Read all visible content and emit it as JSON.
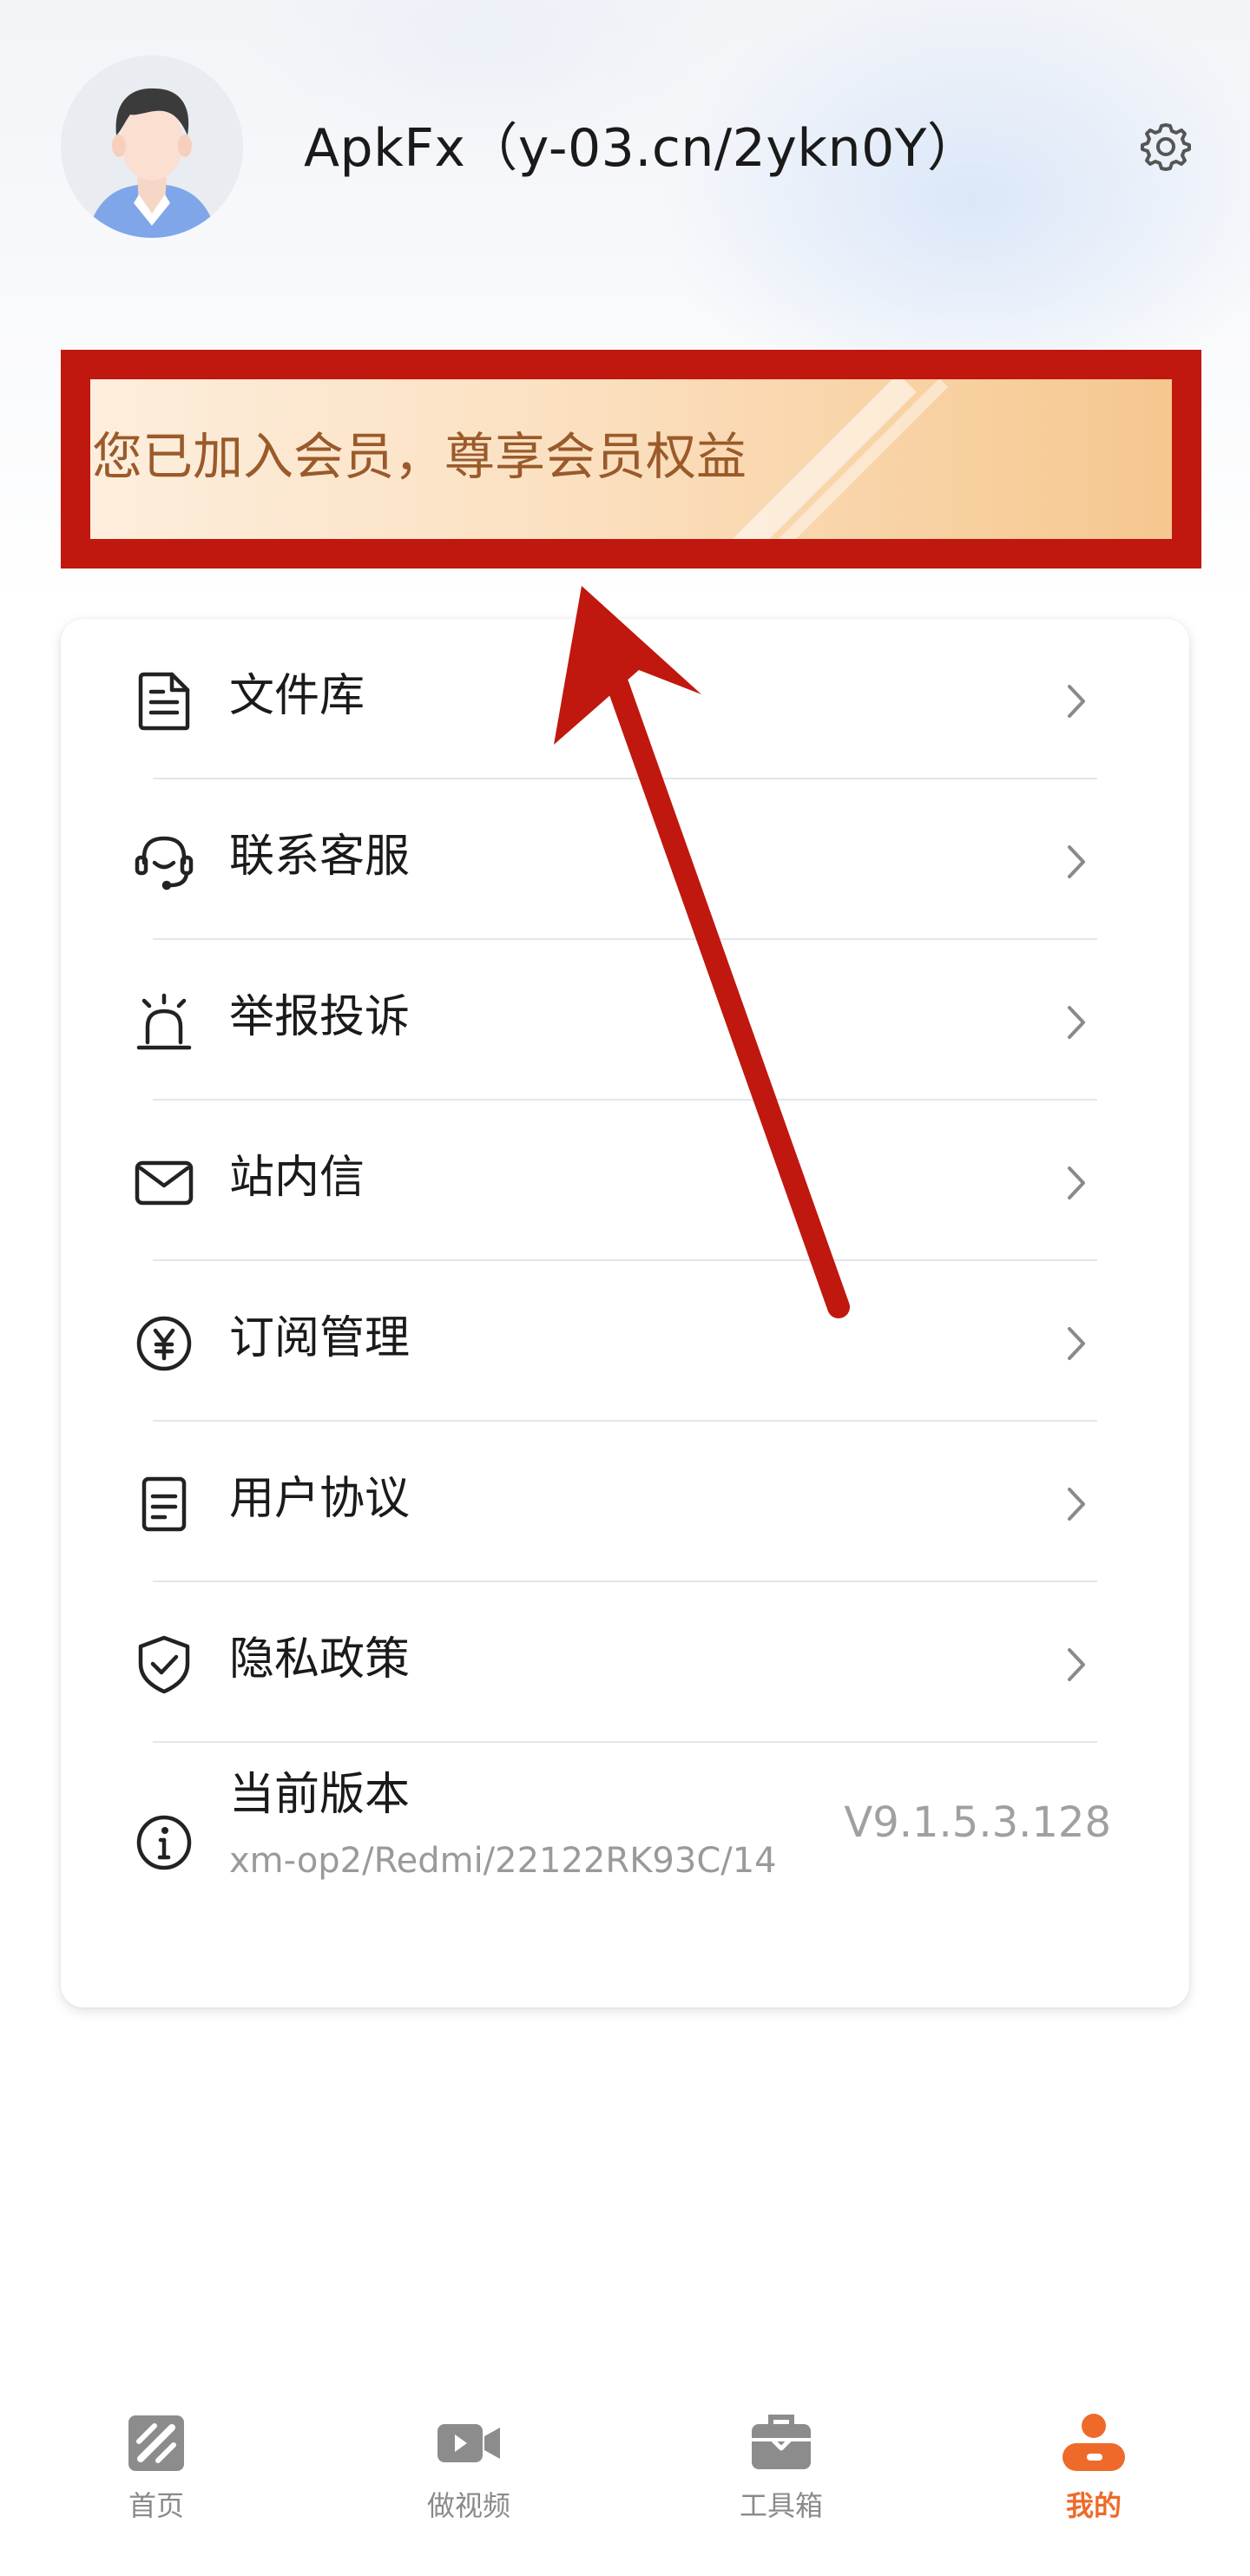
{
  "header": {
    "username": "ApkFx（y-03.cn/2ykn0Y）"
  },
  "vip": {
    "text": "您已加入会员，尊享会员权益"
  },
  "menu": {
    "items": [
      {
        "label": "文件库",
        "icon": "document-icon"
      },
      {
        "label": "联系客服",
        "icon": "headset-icon"
      },
      {
        "label": "举报投诉",
        "icon": "alarm-icon"
      },
      {
        "label": "站内信",
        "icon": "mail-icon"
      },
      {
        "label": "订阅管理",
        "icon": "yen-icon"
      },
      {
        "label": "用户协议",
        "icon": "agreement-icon"
      },
      {
        "label": "隐私政策",
        "icon": "shield-check-icon"
      }
    ],
    "version": {
      "label": "当前版本",
      "device": "xm-op2/Redmi/22122RK93C/14",
      "value": "V9.1.5.3.128"
    }
  },
  "tabbar": {
    "tabs": [
      {
        "label": "首页",
        "icon": "home-icon"
      },
      {
        "label": "做视频",
        "icon": "video-icon"
      },
      {
        "label": "工具箱",
        "icon": "toolbox-icon"
      },
      {
        "label": "我的",
        "icon": "profile-icon",
        "active": true
      }
    ]
  },
  "colors": {
    "accent": "#ee6a2a",
    "annotation_red": "#c0170e",
    "vip_text": "#9a5a2a"
  }
}
